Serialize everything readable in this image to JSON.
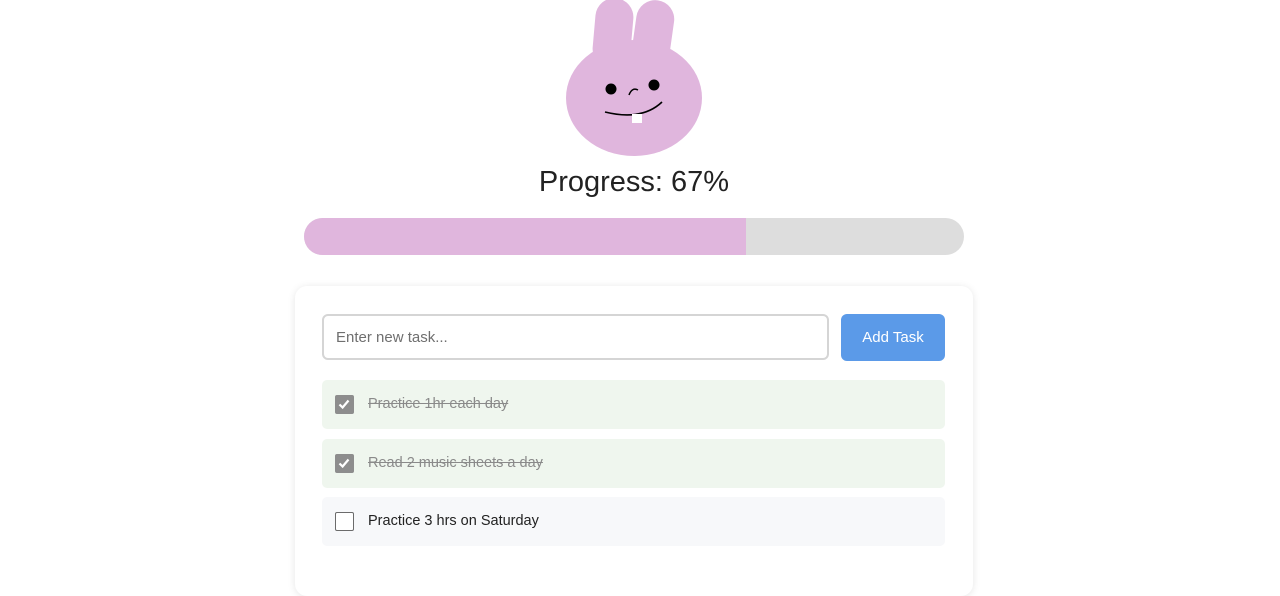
{
  "mascot": {
    "icon": "bunny-icon",
    "color": "#e0b6dd"
  },
  "progress": {
    "label": "Progress: 67%",
    "percent": 67,
    "fill_color": "#e0b6dd",
    "track_color": "#dddddd"
  },
  "task_form": {
    "input_value": "",
    "input_placeholder": "Enter new task...",
    "add_button_label": "Add Task",
    "button_color": "#5b9ae8"
  },
  "tasks": [
    {
      "text": "Practice 1hr each day",
      "completed": true
    },
    {
      "text": "Read 2 music sheets a day",
      "completed": true
    },
    {
      "text": "Practice 3 hrs on Saturday",
      "completed": false
    }
  ]
}
